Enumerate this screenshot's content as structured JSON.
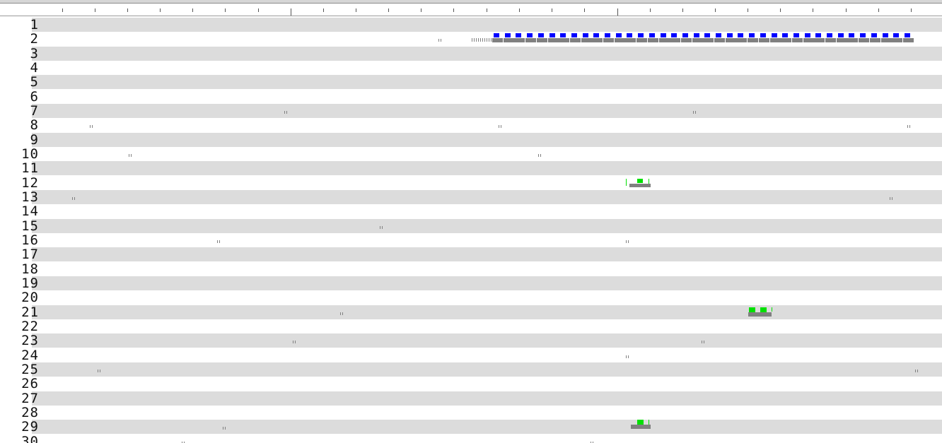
{
  "track_view": {
    "background": "#ffffff",
    "shade_color": "#dcdcdc",
    "tick_color": "#555555",
    "feature_colors": {
      "gray": "#808080",
      "blue": "#0000ff",
      "green": "#00e000"
    }
  },
  "rows": [
    {
      "label": "1"
    },
    {
      "label": "2"
    },
    {
      "label": "3"
    },
    {
      "label": "4"
    },
    {
      "label": "5"
    },
    {
      "label": "6"
    },
    {
      "label": "7"
    },
    {
      "label": "8"
    },
    {
      "label": "9"
    },
    {
      "label": "10"
    },
    {
      "label": "11"
    },
    {
      "label": "12"
    },
    {
      "label": "13"
    },
    {
      "label": "14"
    },
    {
      "label": "15"
    },
    {
      "label": "16"
    },
    {
      "label": "17"
    },
    {
      "label": "18"
    },
    {
      "label": "19"
    },
    {
      "label": "20"
    },
    {
      "label": "21"
    },
    {
      "label": "22"
    },
    {
      "label": "23"
    },
    {
      "label": "24"
    },
    {
      "label": "25"
    },
    {
      "label": "26"
    },
    {
      "label": "27"
    },
    {
      "label": "28"
    },
    {
      "label": "29"
    },
    {
      "label": "30"
    }
  ]
}
